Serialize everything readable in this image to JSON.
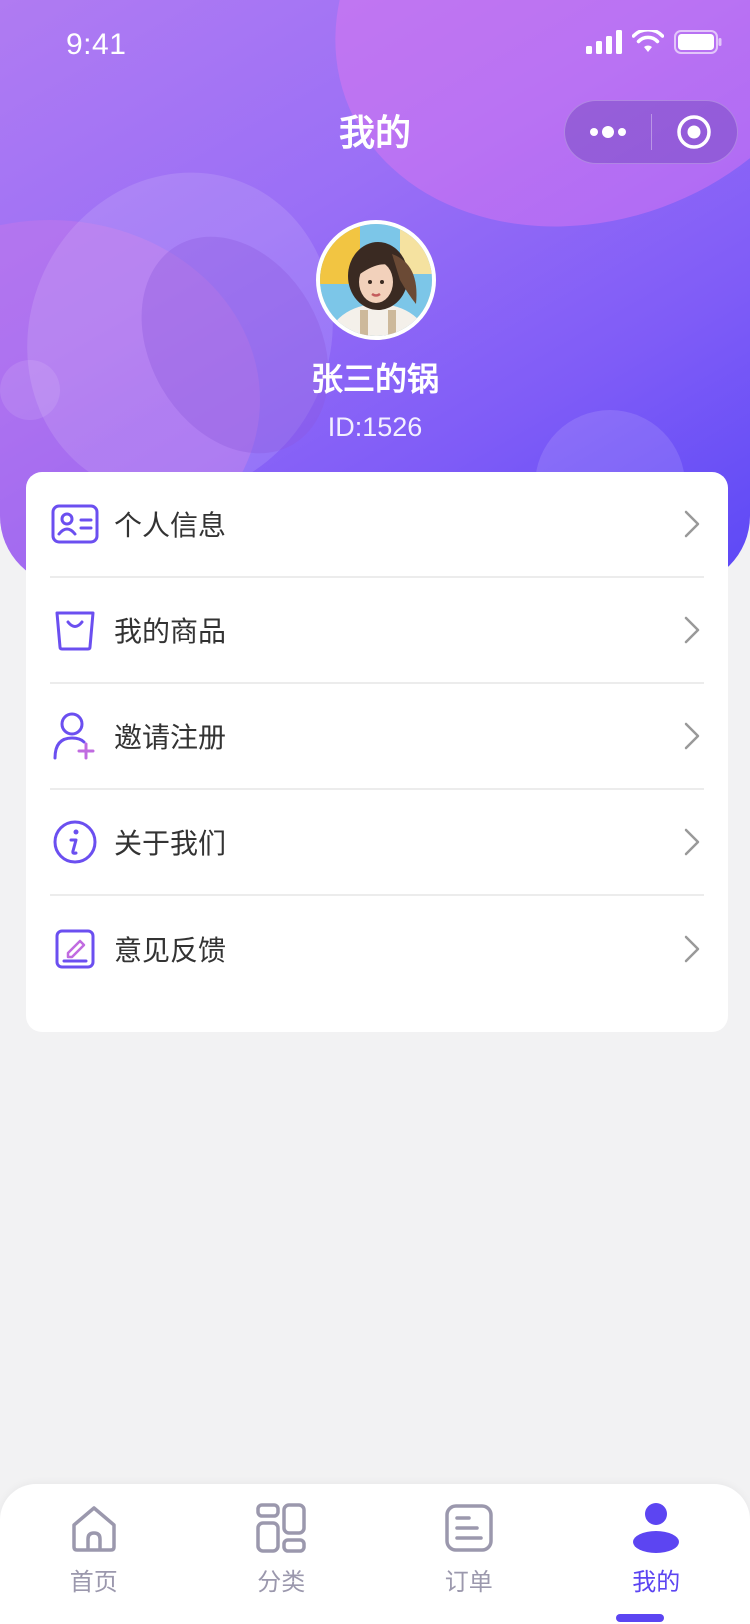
{
  "status_bar": {
    "time": "9:41"
  },
  "nav": {
    "title": "我的"
  },
  "profile": {
    "name": "张三的锅",
    "id_text": "ID:1526"
  },
  "menu": [
    {
      "label": "个人信息",
      "icon": "id-card-icon"
    },
    {
      "label": "我的商品",
      "icon": "shopping-bag-icon"
    },
    {
      "label": "邀请注册",
      "icon": "add-user-icon"
    },
    {
      "label": "关于我们",
      "icon": "info-icon"
    },
    {
      "label": "意见反馈",
      "icon": "feedback-edit-icon"
    }
  ],
  "tabbar": {
    "tabs": [
      {
        "label": "首页",
        "icon": "home-icon",
        "active": false
      },
      {
        "label": "分类",
        "icon": "category-grid-icon",
        "active": false
      },
      {
        "label": "订单",
        "icon": "order-list-icon",
        "active": false
      },
      {
        "label": "我的",
        "icon": "user-icon",
        "active": true
      }
    ]
  },
  "colors": {
    "accent": "#5c45f2",
    "icon_purple": "#6b4ff0",
    "inactive": "#9b98ad",
    "header_gradient": [
      "#b07bf2",
      "#9a6ff6",
      "#7f5cf7",
      "#5b48f6"
    ]
  }
}
